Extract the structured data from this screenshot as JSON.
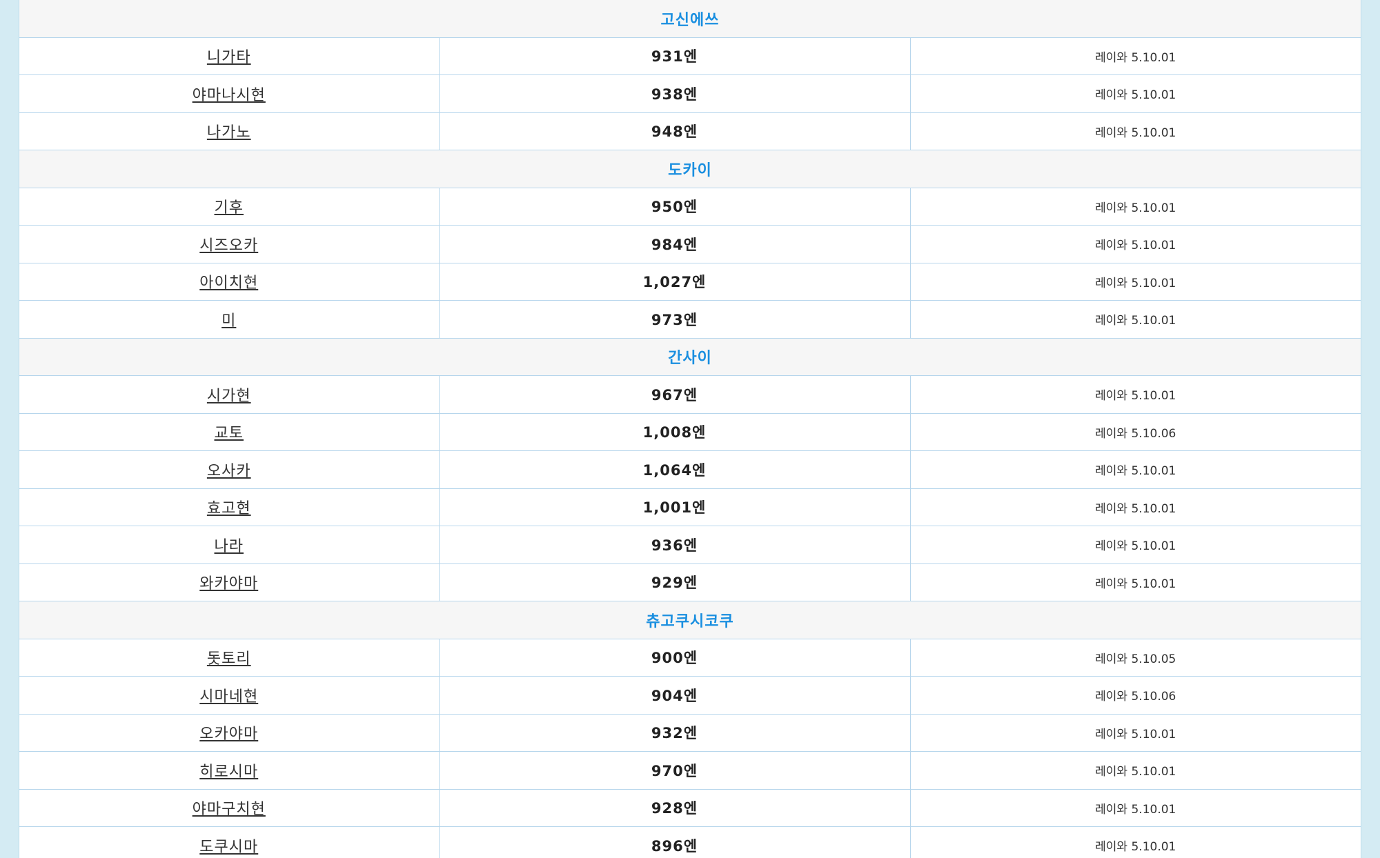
{
  "regions": [
    {
      "name": "고신에쓰",
      "rows": [
        {
          "pref": "니가타",
          "wage": "931엔",
          "date": "레이와 5.10.01"
        },
        {
          "pref": "야마나시현",
          "wage": "938엔",
          "date": "레이와 5.10.01"
        },
        {
          "pref": "나가노",
          "wage": "948엔",
          "date": "레이와 5.10.01"
        }
      ]
    },
    {
      "name": "도카이",
      "rows": [
        {
          "pref": "기후",
          "wage": "950엔",
          "date": "레이와 5.10.01"
        },
        {
          "pref": "시즈오카",
          "wage": "984엔",
          "date": "레이와 5.10.01"
        },
        {
          "pref": "아이치현",
          "wage": "1,027엔",
          "date": "레이와 5.10.01"
        },
        {
          "pref": "미",
          "wage": "973엔",
          "date": "레이와 5.10.01"
        }
      ]
    },
    {
      "name": "간사이",
      "rows": [
        {
          "pref": "시가현",
          "wage": "967엔",
          "date": "레이와 5.10.01"
        },
        {
          "pref": "교토",
          "wage": "1,008엔",
          "date": "레이와 5.10.06"
        },
        {
          "pref": "오사카",
          "wage": "1,064엔",
          "date": "레이와 5.10.01"
        },
        {
          "pref": "효고현",
          "wage": "1,001엔",
          "date": "레이와 5.10.01"
        },
        {
          "pref": "나라",
          "wage": "936엔",
          "date": "레이와 5.10.01"
        },
        {
          "pref": "와카야마",
          "wage": "929엔",
          "date": "레이와 5.10.01"
        }
      ]
    },
    {
      "name": "츄고쿠시코쿠",
      "rows": [
        {
          "pref": "돗토리",
          "wage": "900엔",
          "date": "레이와 5.10.05"
        },
        {
          "pref": "시마네현",
          "wage": "904엔",
          "date": "레이와 5.10.06"
        },
        {
          "pref": "오카야마",
          "wage": "932엔",
          "date": "레이와 5.10.01"
        },
        {
          "pref": "히로시마",
          "wage": "970엔",
          "date": "레이와 5.10.01"
        },
        {
          "pref": "야마구치현",
          "wage": "928엔",
          "date": "레이와 5.10.01"
        },
        {
          "pref": "도쿠시마",
          "wage": "896엔",
          "date": "레이와 5.10.01"
        }
      ]
    }
  ]
}
